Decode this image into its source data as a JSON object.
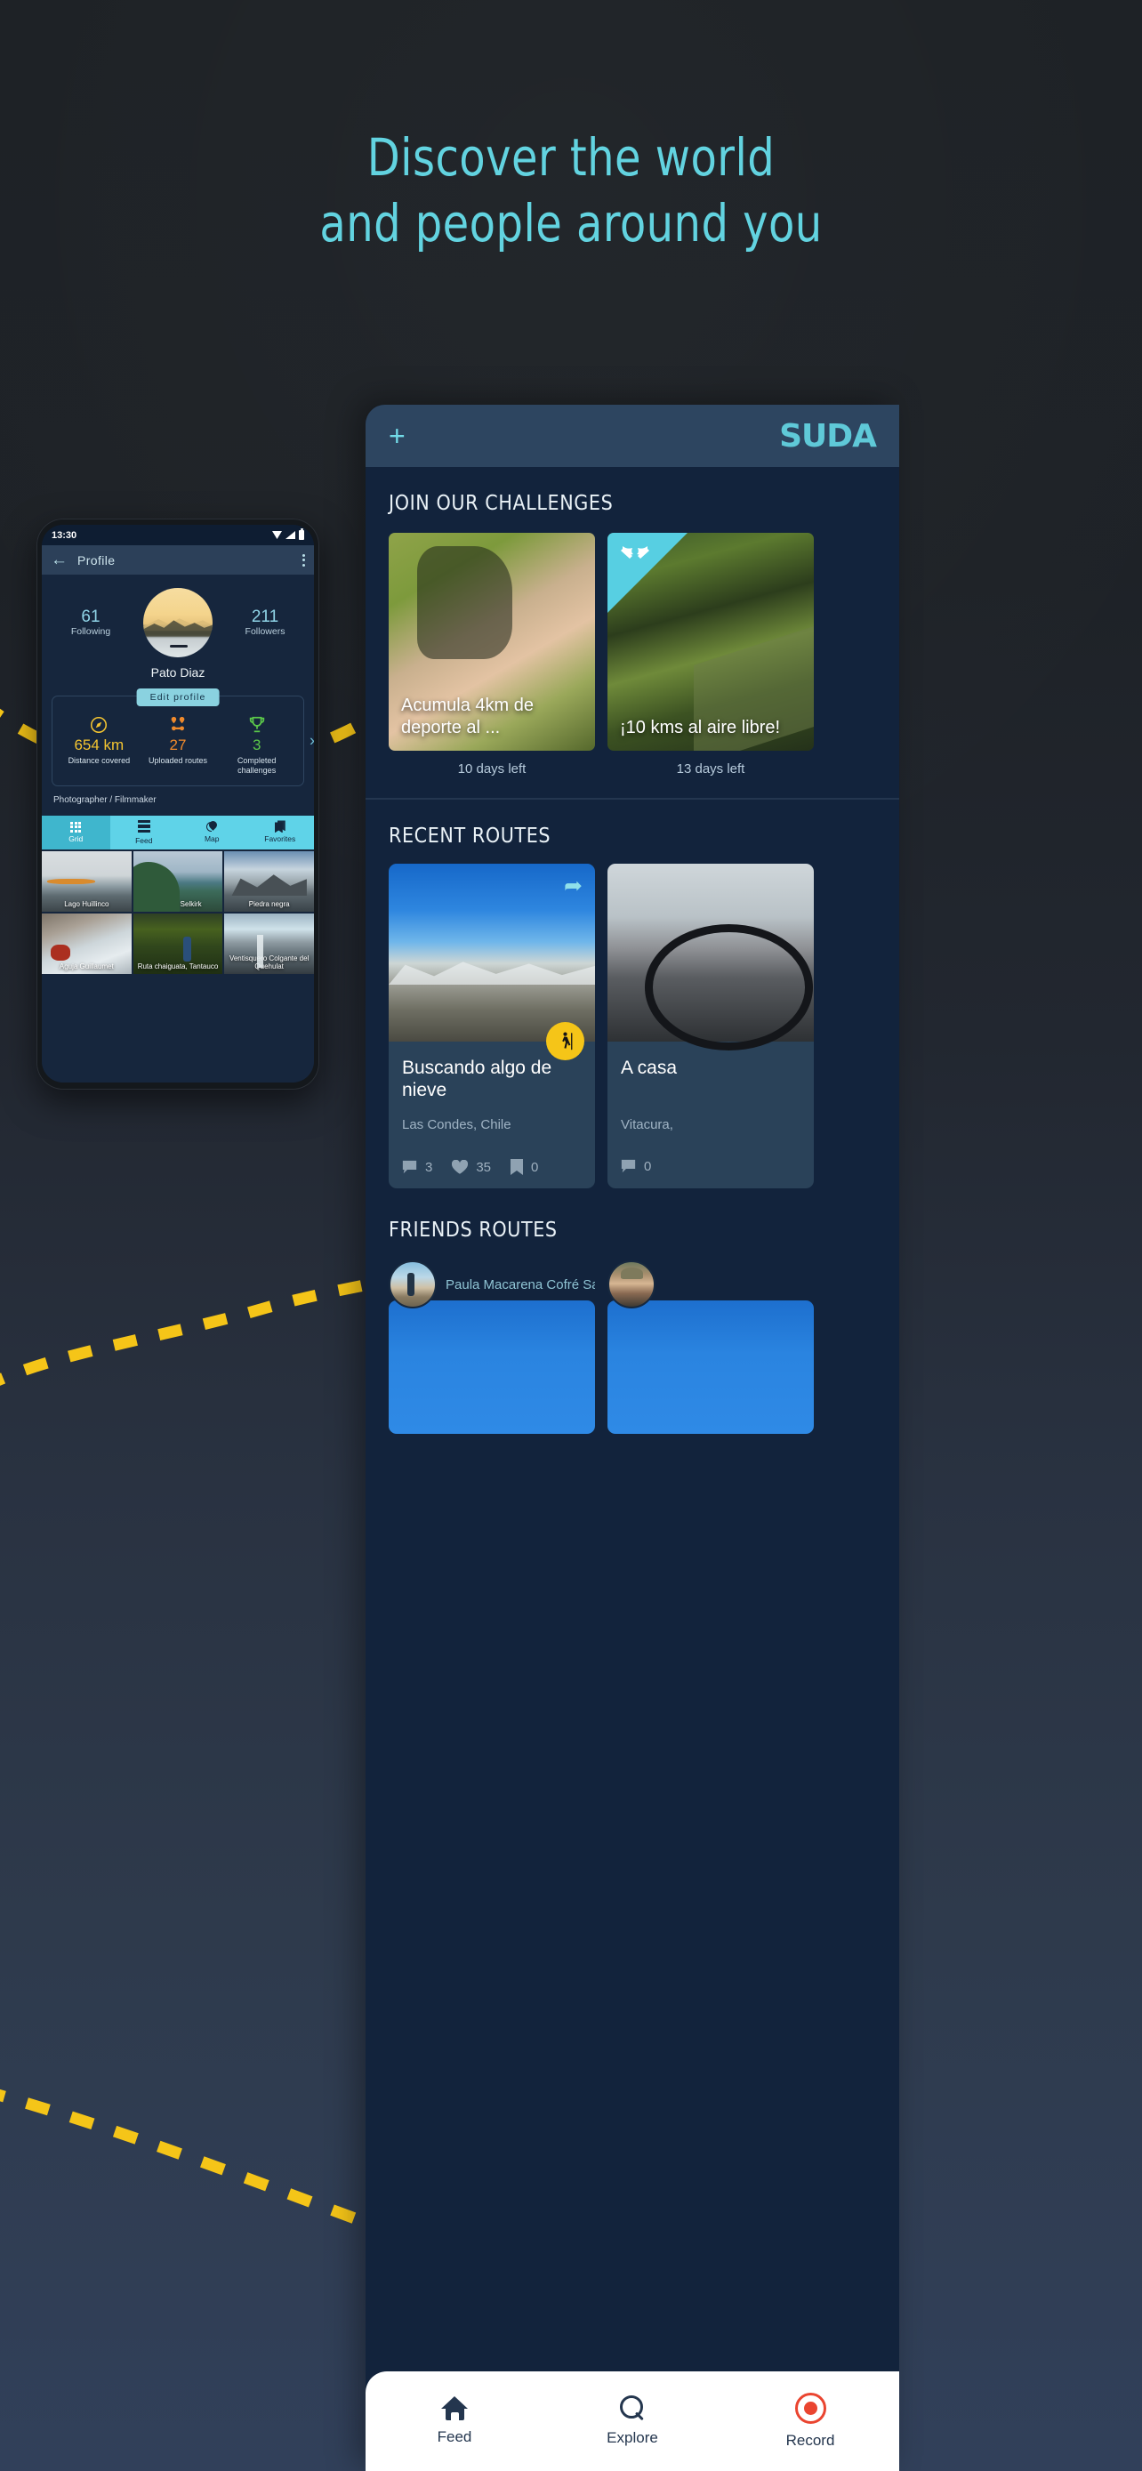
{
  "hero": {
    "line1": "Discover the world",
    "line2": "and people around you",
    "accent_color": "#62d3e0"
  },
  "phone": {
    "status": {
      "time": "13:30",
      "icons": [
        "wifi-icon",
        "signal-icon",
        "battery-icon"
      ]
    },
    "appbar": {
      "back_icon": "back-arrow-icon",
      "title": "Profile",
      "menu_icon": "overflow-menu-icon"
    },
    "profile": {
      "following_count": "61",
      "following_label": "Following",
      "followers_count": "211",
      "followers_label": "Followers",
      "name": "Pato Diaz",
      "edit_button": "Edit profile",
      "bio": "Photographer / Filmmaker",
      "next_icon": "chevron-right-icon"
    },
    "stats": [
      {
        "icon": "compass-icon",
        "value": "654 km",
        "caption": "Distance covered",
        "color": "#f3c431"
      },
      {
        "icon": "route-pins-icon",
        "value": "27",
        "caption": "Uploaded routes",
        "color": "#f08a2c"
      },
      {
        "icon": "trophy-icon",
        "value": "3",
        "caption": "Completed challenges",
        "color": "#5bc84a"
      }
    ],
    "tabs": [
      {
        "label": "Grid",
        "icon": "grid-icon",
        "active": true
      },
      {
        "label": "Feed",
        "icon": "feed-icon",
        "active": false
      },
      {
        "label": "Map",
        "icon": "map-pin-icon",
        "active": false
      },
      {
        "label": "Favorites",
        "icon": "bookmark-icon",
        "active": false
      }
    ],
    "grid": [
      {
        "caption": "Lago Huillinco"
      },
      {
        "caption": "Mirador Selkirk"
      },
      {
        "caption": "Piedra negra"
      },
      {
        "caption": "Aguja Guillaumet"
      },
      {
        "caption": "Ruta chaiguata, Tantauco"
      },
      {
        "caption": "Ventisquero Colgante del Quehulat"
      }
    ]
  },
  "app": {
    "topbar": {
      "add_icon": "plus-icon",
      "logo": "SUDA"
    },
    "challenges": {
      "section_title": "JOIN OUR CHALLENGES",
      "items": [
        {
          "title": "Acumula 4km de deporte al ...",
          "days_left": "10 days left",
          "ribbon": false
        },
        {
          "title": "¡10 kms al aire libre!",
          "days_left": "13 days left",
          "ribbon": true,
          "ribbon_icon": "crossed-flags-icon"
        }
      ]
    },
    "recent_routes": {
      "section_title": "RECENT ROUTES",
      "items": [
        {
          "title": "Buscando algo de nieve",
          "location": "Las Condes, Chile",
          "share_icon": "share-icon",
          "activity_icon": "hiker-icon",
          "comments": "3",
          "likes": "35",
          "saves": "0"
        },
        {
          "title": "A casa",
          "location": "Vitacura,",
          "comments": "0",
          "likes": "",
          "saves": ""
        }
      ]
    },
    "friends_routes": {
      "section_title": "FRIENDS ROUTES",
      "items": [
        {
          "name": "Paula Macarena Cofré Sap..."
        },
        {
          "name": ""
        }
      ]
    },
    "bottom_nav": [
      {
        "label": "Feed",
        "icon": "home-icon"
      },
      {
        "label": "Explore",
        "icon": "search-icon"
      },
      {
        "label": "Record",
        "icon": "record-icon"
      }
    ]
  }
}
